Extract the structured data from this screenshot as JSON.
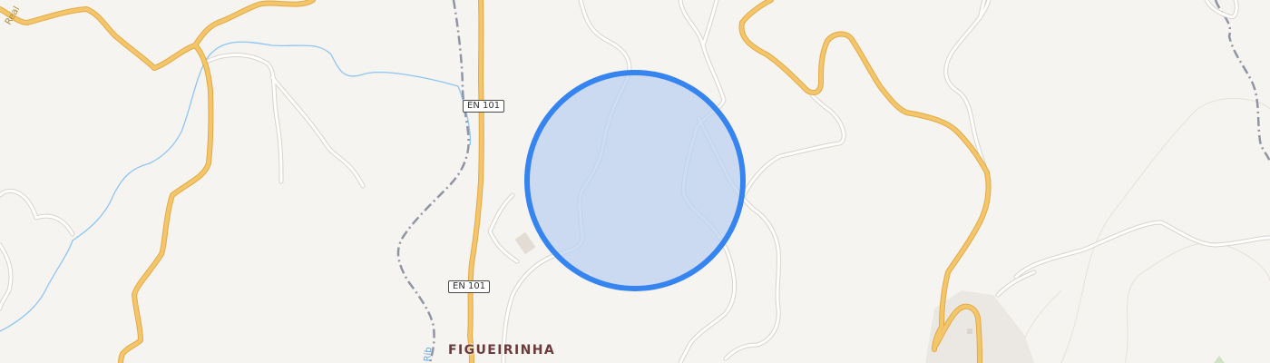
{
  "map": {
    "place_label": "FIGUEIRINHA",
    "road_shields": [
      "EN 101",
      "EN 101"
    ],
    "edge_label_left": "Real",
    "river_fragment": "Rib",
    "colors": {
      "background": "#f6f4f0",
      "major_road": "#f3c66b",
      "major_road_casing": "#e3aa45",
      "minor_road": "#ffffff",
      "minor_road_casing": "#d8d4cc",
      "river": "#8ec5f2",
      "boundary": "#8f95a3",
      "circle_fill": "#c9dbf4",
      "circle_stroke": "#3584f0"
    }
  }
}
